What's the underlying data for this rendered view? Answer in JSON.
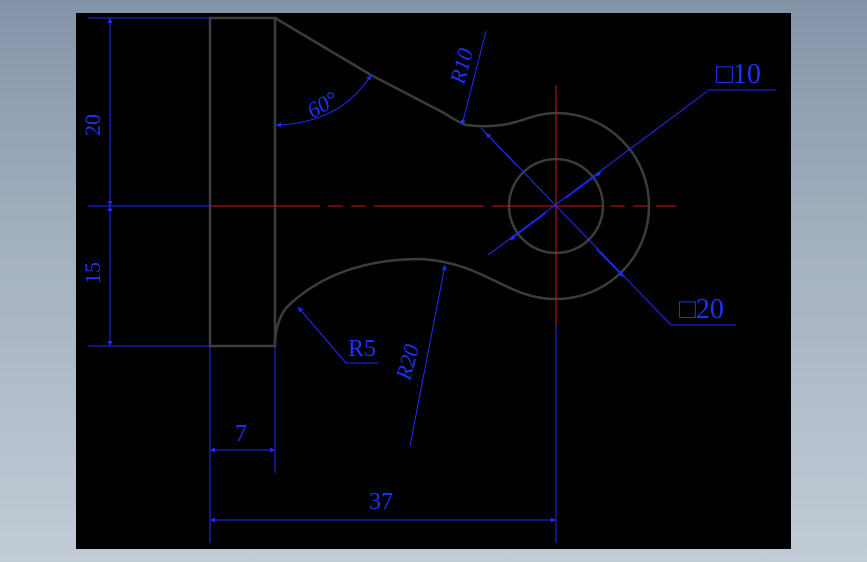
{
  "drawing": {
    "colors": {
      "background": "#000000",
      "outline": "#3c3c3c",
      "dimension": "#1f2bff",
      "centerline": "#c81414"
    },
    "dimensions": {
      "dim_20": "20",
      "dim_15": "15",
      "dim_60deg": "60°",
      "dim_r10": "R10",
      "dim_sq10": "□10",
      "dim_sq20": "□20",
      "dim_r5": "R5",
      "dim_r20": "R20",
      "dim_7": "7",
      "dim_37": "37"
    }
  }
}
